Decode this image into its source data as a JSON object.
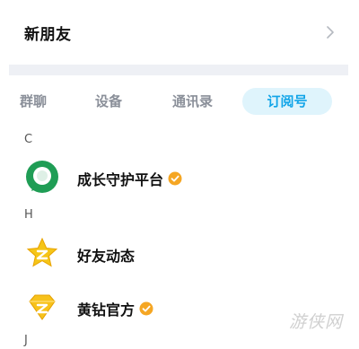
{
  "new_friends": {
    "label": "新朋友"
  },
  "tabs": [
    {
      "label": "群聊",
      "active": false
    },
    {
      "label": "设备",
      "active": false
    },
    {
      "label": "通讯录",
      "active": false
    },
    {
      "label": "订阅号",
      "active": true
    }
  ],
  "sections": [
    {
      "letter": "C",
      "items": [
        {
          "name": "成长守护平台",
          "icon": "growth-guard-icon",
          "verified": true
        }
      ]
    },
    {
      "letter": "H",
      "items": [
        {
          "name": "好友动态",
          "icon": "qzone-star-icon",
          "verified": false
        },
        {
          "name": "黄钻官方",
          "icon": "yellow-diamond-icon",
          "verified": true
        }
      ]
    },
    {
      "letter": "J",
      "items": []
    }
  ],
  "watermark": "游侠网",
  "colors": {
    "accent_blue": "#10a4e8",
    "active_tab_bg": "#dff4fc",
    "badge_orange": "#f5a623",
    "growth_green": "#1f9d55",
    "separator": "#eef0f5"
  }
}
